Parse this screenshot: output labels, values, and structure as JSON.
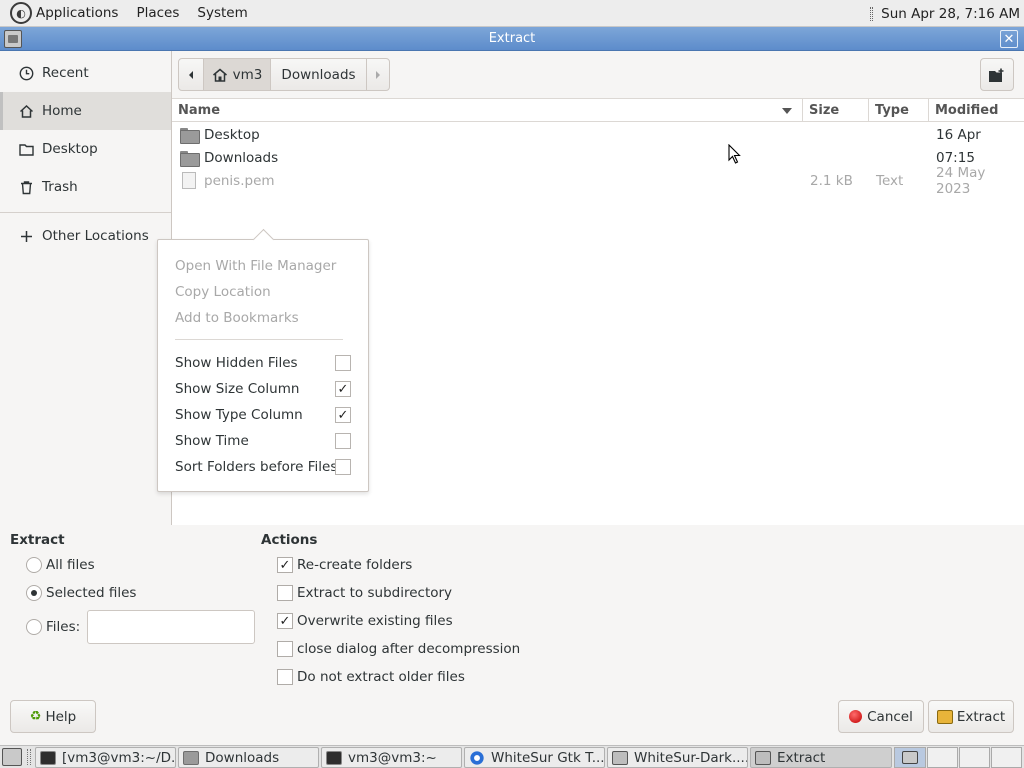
{
  "top_panel": {
    "menus": [
      "Applications",
      "Places",
      "System"
    ],
    "clock": "Sun Apr 28,  7:16 AM"
  },
  "window": {
    "title": "Extract"
  },
  "sidebar": {
    "items": [
      {
        "label": "Recent",
        "icon": "clock-icon"
      },
      {
        "label": "Home",
        "icon": "home-icon",
        "active": true
      },
      {
        "label": "Desktop",
        "icon": "folder-icon"
      },
      {
        "label": "Trash",
        "icon": "trash-icon"
      }
    ],
    "other_locations": "Other Locations"
  },
  "pathbar": {
    "home": "vm3",
    "current": "Downloads"
  },
  "columns": {
    "name": "Name",
    "size": "Size",
    "type": "Type",
    "modified": "Modified"
  },
  "files": [
    {
      "name": "Desktop",
      "size": "",
      "type": "",
      "modified": "16 Apr"
    },
    {
      "name": "Downloads",
      "size": "",
      "type": "",
      "modified": "07:15"
    },
    {
      "name": "penis.pem",
      "size": "2.1 kB",
      "type": "Text",
      "modified": "24 May 2023"
    }
  ],
  "popover": {
    "disabled_items": [
      "Open With File Manager",
      "Copy Location",
      "Add to Bookmarks"
    ],
    "toggles": [
      {
        "label": "Show Hidden Files",
        "checked": false
      },
      {
        "label": "Show Size Column",
        "checked": true
      },
      {
        "label": "Show Type Column",
        "checked": true
      },
      {
        "label": "Show Time",
        "checked": false
      },
      {
        "label": "Sort Folders before Files",
        "checked": false
      }
    ]
  },
  "extract": {
    "heading": "Extract",
    "all_files": "All files",
    "selected_files": "Selected files",
    "files_label": "Files:",
    "files_value": "",
    "selected": "selected"
  },
  "actions": {
    "heading": "Actions",
    "items": [
      {
        "label": "Re-create folders",
        "checked": true
      },
      {
        "label": "Extract to subdirectory",
        "checked": false
      },
      {
        "label": "Overwrite existing files",
        "checked": true
      },
      {
        "label": "close dialog after decompression",
        "checked": false
      },
      {
        "label": "Do not extract older files",
        "checked": false
      }
    ]
  },
  "buttons": {
    "help": "Help",
    "cancel": "Cancel",
    "extract": "Extract"
  },
  "taskbar": {
    "items": [
      {
        "label": "[vm3@vm3:~/D...",
        "icon": "terminal-icon"
      },
      {
        "label": "Downloads",
        "icon": "folder-icon"
      },
      {
        "label": "vm3@vm3:~",
        "icon": "terminal-icon"
      },
      {
        "label": "WhiteSur Gtk T...",
        "icon": "browser-icon"
      },
      {
        "label": "WhiteSur-Dark....",
        "icon": "archive-icon"
      },
      {
        "label": "Extract",
        "icon": "archive-icon",
        "active": true
      }
    ]
  }
}
